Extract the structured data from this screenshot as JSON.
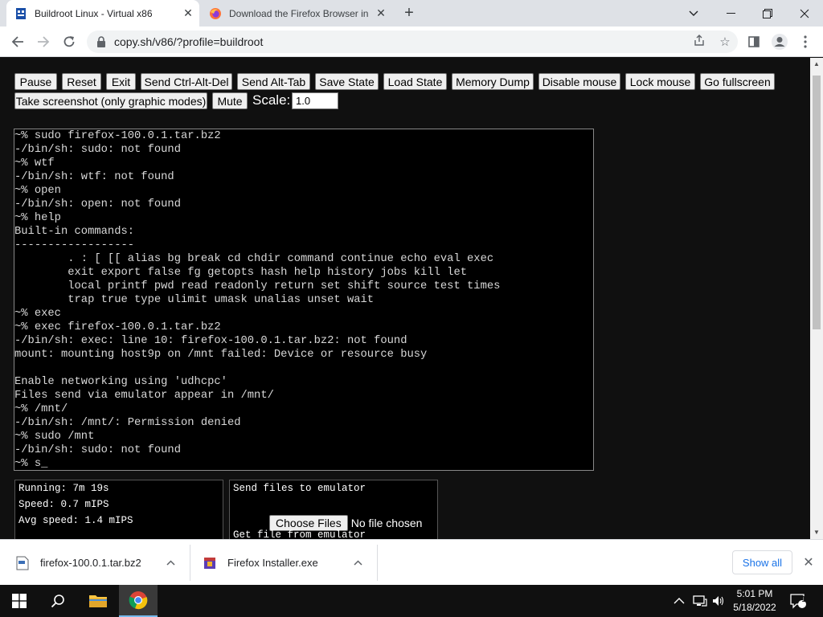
{
  "tabs": [
    {
      "title": "Buildroot Linux - Virtual x86",
      "active": true
    },
    {
      "title": "Download the Firefox Browser in",
      "active": false
    }
  ],
  "address": {
    "url": "copy.sh/v86/?profile=buildroot"
  },
  "controls": {
    "buttons_row1": [
      "Pause",
      "Reset",
      "Exit",
      "Send Ctrl-Alt-Del",
      "Send Alt-Tab",
      "Save State",
      "Load State",
      "Memory Dump",
      "Disable mouse",
      "Lock mouse",
      "Go fullscreen"
    ],
    "screenshot_label": "Take screenshot (only graphic modes)",
    "mute_label": "Mute",
    "scale_label": "Scale:",
    "scale_value": "1.0"
  },
  "terminal": {
    "lines": [
      "~% sudo firefox-100.0.1.tar.bz2",
      "-/bin/sh: sudo: not found",
      "~% wtf",
      "-/bin/sh: wtf: not found",
      "~% open",
      "-/bin/sh: open: not found",
      "~% help",
      "Built-in commands:",
      "------------------",
      "        . : [ [[ alias bg break cd chdir command continue echo eval exec",
      "        exit export false fg getopts hash help history jobs kill let",
      "        local printf pwd read readonly return set shift source test times",
      "        trap true type ulimit umask unalias unset wait",
      "~% exec",
      "~% exec firefox-100.0.1.tar.bz2",
      "-/bin/sh: exec: line 10: firefox-100.0.1.tar.bz2: not found",
      "mount: mounting host9p on /mnt failed: Device or resource busy",
      "",
      "Enable networking using 'udhcpc'",
      "Files send via emulator appear in /mnt/",
      "~% /mnt/",
      "-/bin/sh: /mnt/: Permission denied",
      "~% sudo /mnt",
      "-/bin/sh: sudo: not found",
      "~% s_"
    ]
  },
  "stats": {
    "running": "Running: 7m 19s",
    "speed": "Speed: 0.7 mIPS",
    "avg_speed": "Avg speed: 1.4 mIPS"
  },
  "files": {
    "send_title": "Send files to emulator",
    "choose_label": "Choose Files",
    "no_file": "No file chosen",
    "get_title": "Get file from emulator"
  },
  "downloads": {
    "items": [
      {
        "name": "firefox-100.0.1.tar.bz2",
        "icon": "archive-file-icon"
      },
      {
        "name": "Firefox Installer.exe",
        "icon": "installer-file-icon"
      }
    ],
    "show_all": "Show all"
  },
  "taskbar": {
    "time": "5:01 PM",
    "date": "5/18/2022",
    "notification_count": "1"
  }
}
